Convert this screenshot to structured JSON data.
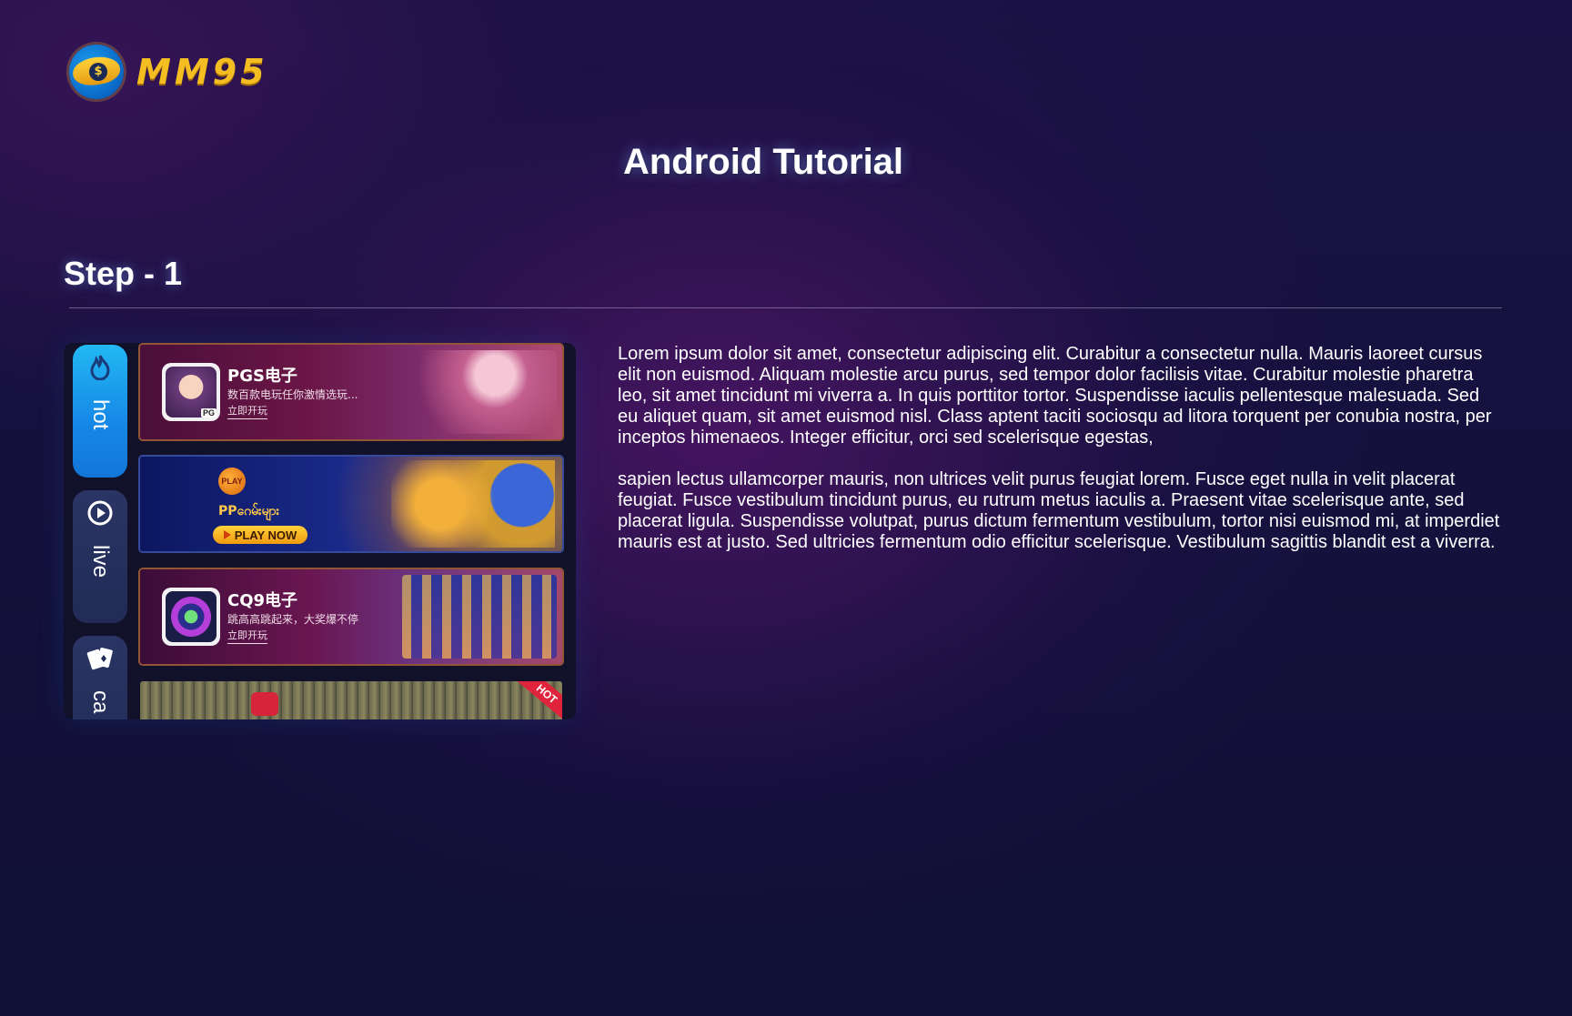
{
  "brand": {
    "name": "MM95",
    "logo_icon": "dollar-coin-wings-icon",
    "accent_color": "#f4be22"
  },
  "page": {
    "title": "Android Tutorial"
  },
  "step": {
    "title": "Step - 1"
  },
  "mock": {
    "tabs": [
      {
        "label": "hot",
        "icon": "flame-icon",
        "active": true
      },
      {
        "label": "live",
        "icon": "play-circle-icon",
        "active": false
      },
      {
        "label": "ca",
        "icon": "cards-icon",
        "active": false
      }
    ],
    "banners": [
      {
        "id": "pg",
        "title": "PGS电子",
        "subtitle": "数百款电玩任你激情选玩...",
        "cta": "立即开玩",
        "thumb_tag": "PG"
      },
      {
        "id": "pp",
        "play_badge": "PLAY",
        "headline": "PPဂေမ်းများ",
        "button": "PLAY NOW"
      },
      {
        "id": "cq9",
        "title": "CQ9电子",
        "subtitle": "跳高高跳起来，大奖爆不停",
        "cta": "立即开玩"
      },
      {
        "id": "sport",
        "ribbon": "HOT"
      }
    ]
  },
  "content": {
    "paragraphs": [
      "Lorem ipsum dolor sit amet, consectetur adipiscing elit. Curabitur a consectetur nulla. Mauris laoreet cursus elit non euismod. Aliquam molestie arcu purus, sed tempor dolor facilisis vitae. Curabitur molestie pharetra leo, sit amet tincidunt mi viverra a. In quis porttitor tortor. Suspendisse iaculis pellentesque malesuada. Sed eu aliquet quam, sit amet euismod nisl. Class aptent taciti sociosqu ad litora torquent per conubia nostra, per inceptos himenaeos. Integer efficitur, orci sed scelerisque egestas,",
      "sapien lectus ullamcorper mauris, non ultrices velit purus feugiat lorem. Fusce eget nulla in velit placerat feugiat. Fusce vestibulum tincidunt purus, eu rutrum metus iaculis a. Praesent vitae scelerisque ante, sed placerat ligula. Suspendisse volutpat, purus dictum fermentum vestibulum, tortor nisi euismod mi, at imperdiet mauris est at justo. Sed ultricies fermentum odio efficitur scelerisque. Vestibulum sagittis blandit est a viverra."
    ]
  }
}
